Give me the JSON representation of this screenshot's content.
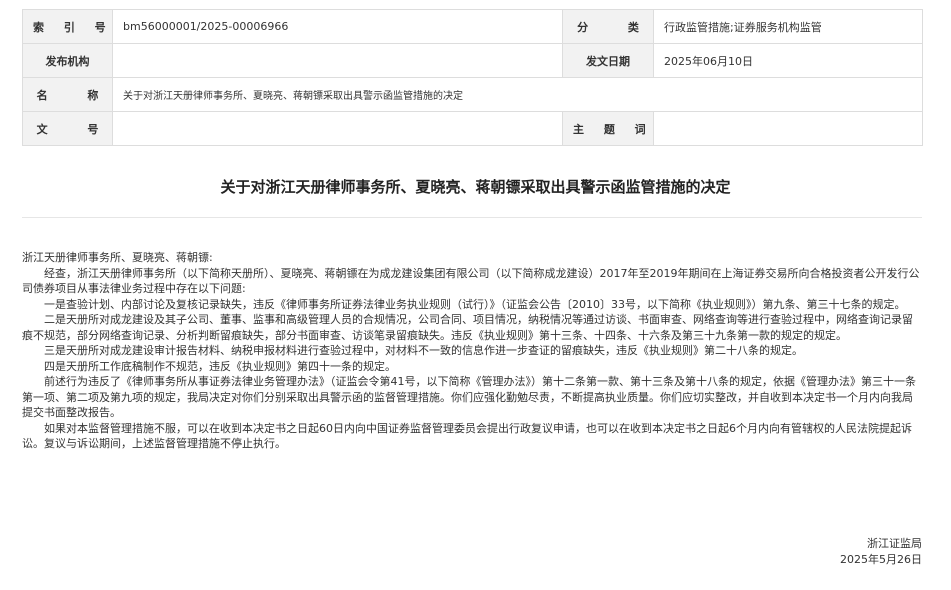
{
  "meta": {
    "index_label": "索 引 号",
    "index_value": "bm56000001/2025-00006966",
    "category_label": "分 类",
    "category_value": "行政监管措施;证券服务机构监管",
    "issuer_label": "发布机构",
    "issuer_value": "",
    "date_label": "发文日期",
    "date_value": "2025年06月10日",
    "name_label": "名 称",
    "name_value": "关于对浙江天册律师事务所、夏晓亮、蒋朝镖采取出具警示函监管措施的决定",
    "docno_label": "文 号",
    "docno_value": "",
    "subject_label": "主 题 词",
    "subject_value": ""
  },
  "title": "关于对浙江天册律师事务所、夏晓亮、蒋朝镖采取出具警示函监管措施的决定",
  "paragraphs": [
    "浙江天册律师事务所、夏晓亮、蒋朝镖:",
    "经查，浙江天册律师事务所（以下简称天册所）、夏晓亮、蒋朝镖在为成龙建设集团有限公司（以下简称成龙建设）2017年至2019年期间在上海证券交易所向合格投资者公开发行公司债券项目从事法律业务过程中存在以下问题:",
    "一是查验计划、内部讨论及复核记录缺失，违反《律师事务所证券法律业务执业规则（试行）》（证监会公告〔2010〕33号，以下简称《执业规则》）第九条、第三十七条的规定。",
    "二是天册所对成龙建设及其子公司、董事、监事和高级管理人员的合规情况，公司合同、项目情况，纳税情况等通过访谈、书面审查、网络查询等进行查验过程中，网络查询记录留痕不规范，部分网络查询记录、分析判断留痕缺失，部分书面审查、访谈笔录留痕缺失。违反《执业规则》第十三条、十四条、十六条及第三十九条第一款的规定的规定。",
    "三是天册所对成龙建设审计报告材料、纳税申报材料进行查验过程中，对材料不一致的信息作进一步查证的留痕缺失，违反《执业规则》第二十八条的规定。",
    "四是天册所工作底稿制作不规范，违反《执业规则》第四十一条的规定。",
    "前述行为违反了《律师事务所从事证券法律业务管理办法》（证监会令第41号，以下简称《管理办法》）第十二条第一款、第十三条及第十八条的规定，依据《管理办法》第三十一条第一项、第二项及第九项的规定，我局决定对你们分别采取出具警示函的监督管理措施。你们应强化勤勉尽责，不断提高执业质量。你们应切实整改，并自收到本决定书一个月内向我局提交书面整改报告。",
    "如果对本监督管理措施不服，可以在收到本决定书之日起60日内向中国证券监督管理委员会提出行政复议申请，也可以在收到本决定书之日起6个月内向有管辖权的人民法院提起诉讼。复议与诉讼期间，上述监督管理措施不停止执行。"
  ],
  "signature": {
    "org": "浙江证监局",
    "date": "2025年5月26日"
  }
}
